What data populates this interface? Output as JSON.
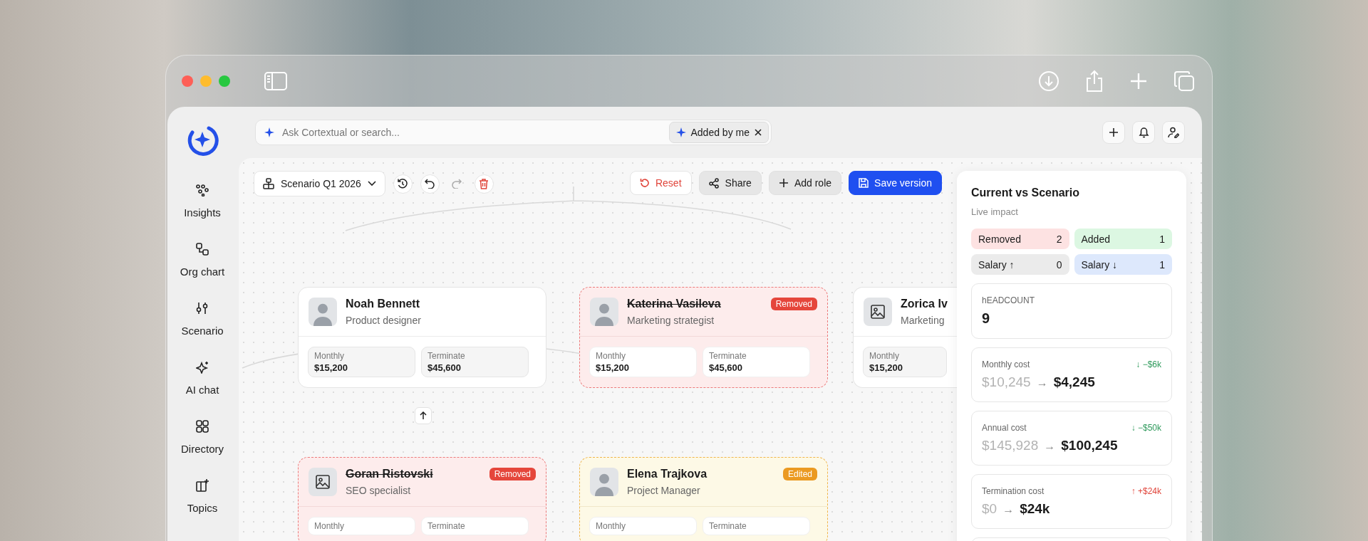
{
  "search": {
    "placeholder": "Ask Cortextual or search...",
    "filter_chip": "Added by me"
  },
  "sidebar": {
    "items": [
      {
        "label": "Insights",
        "kind": "insights"
      },
      {
        "label": "Org chart",
        "kind": "org"
      },
      {
        "label": "Scenario",
        "kind": "scenario"
      },
      {
        "label": "AI chat",
        "kind": "ai"
      },
      {
        "label": "Directory",
        "kind": "directory"
      },
      {
        "label": "Topics",
        "kind": "topics"
      }
    ]
  },
  "scenario": {
    "name": "Scenario Q1 2026"
  },
  "toolbar_buttons": [
    {
      "label": "Reset",
      "kind": "danger"
    },
    {
      "label": "Share",
      "kind": "secondary"
    },
    {
      "label": "Add role",
      "kind": "secondary"
    },
    {
      "label": "Save version",
      "kind": "primary"
    }
  ],
  "cards": [
    {
      "name": "Noah Bennett",
      "role": "Product designer",
      "kind": "normal",
      "avatar": {
        "kind": "photo"
      },
      "fields": [
        {
          "label": "Monthly",
          "value": "$15,200"
        },
        {
          "label": "Terminate",
          "value": "$45,600"
        }
      ]
    },
    {
      "name": "Katerina Vasileva",
      "role": "Marketing strategist",
      "kind": "removed",
      "badge": "Removed",
      "avatar": {
        "kind": "photo"
      },
      "fields": [
        {
          "label": "Monthly",
          "value": "$15,200"
        },
        {
          "label": "Terminate",
          "value": "$45,600"
        }
      ]
    },
    {
      "name": "Zorica Iv",
      "role": "Marketing",
      "kind": "normal",
      "avatar": {
        "kind": "placeholder"
      },
      "fields": [
        {
          "label": "Monthly",
          "value": "$15,200"
        }
      ]
    },
    {
      "name": "Goran Ristovski",
      "role": "SEO specialist",
      "kind": "removed",
      "badge": "Removed",
      "avatar": {
        "kind": "placeholder"
      },
      "fields": [
        {
          "label": "Monthly"
        },
        {
          "label": "Terminate"
        }
      ]
    },
    {
      "name": "Elena Trajkova",
      "role": "Project Manager",
      "kind": "edited",
      "badge": "Edited",
      "avatar": {
        "kind": "photo"
      },
      "fields": [
        {
          "label": "Monthly"
        },
        {
          "label": "Terminate"
        }
      ]
    }
  ],
  "impact": {
    "title": "Current vs Scenario",
    "subtitle": "Live impact",
    "counters": [
      {
        "label": "Removed",
        "count": "2",
        "color": "#fde2e2"
      },
      {
        "label": "Added",
        "count": "1",
        "color": "#dcf7e2"
      },
      {
        "label": "Salary ↑",
        "count": "0",
        "color": "#ebebeb"
      },
      {
        "label": "Salary ↓",
        "count": "1",
        "color": "#dde8fc"
      }
    ],
    "headcount": {
      "label": "hEADCOUNT",
      "value": "9"
    },
    "costs": [
      {
        "label": "Monthly cost",
        "kind": "down",
        "delta": "↓ −$6k",
        "from": "$10,245",
        "arrow": "→",
        "to": "$4,245"
      },
      {
        "label": "Annual cost",
        "kind": "down",
        "delta": "↓ −$50k",
        "from": "$145,928",
        "arrow": "→",
        "to": "$100,245"
      },
      {
        "label": "Termination cost",
        "kind": "up",
        "delta": "↑ +$24k",
        "from": "$0",
        "arrow": "→",
        "to": "$24k"
      }
    ]
  }
}
